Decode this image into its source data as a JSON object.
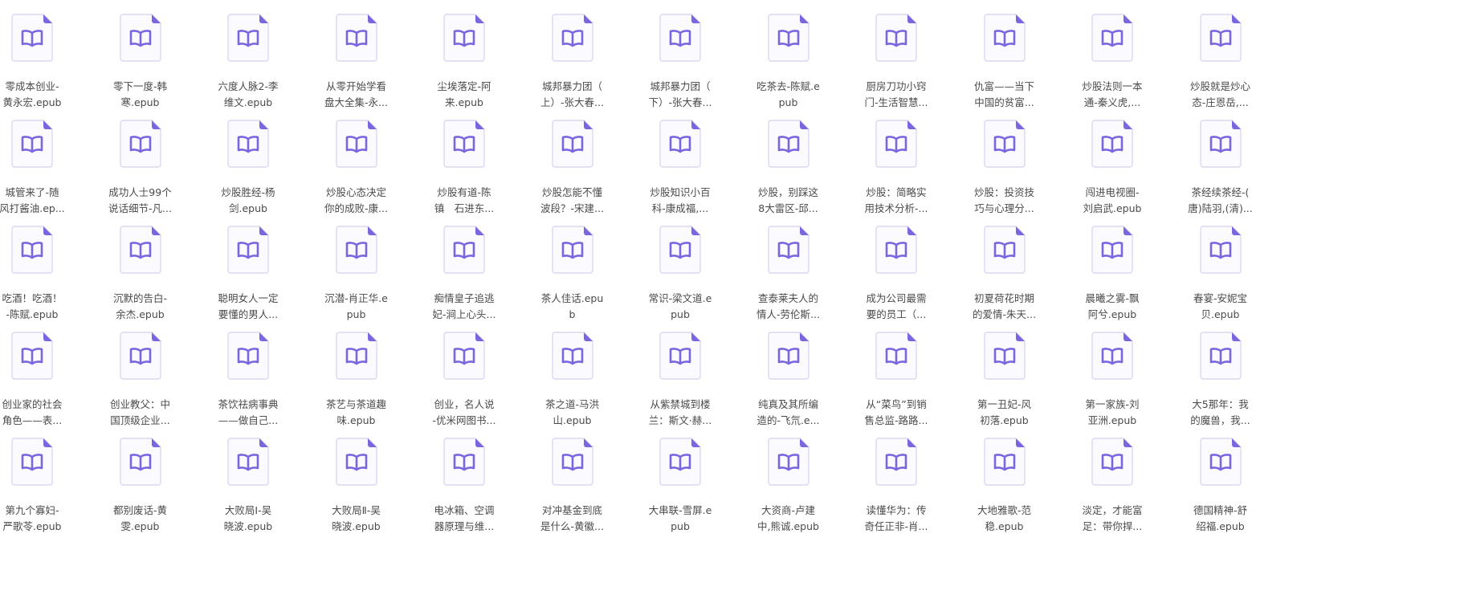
{
  "colors": {
    "icon_stroke": "#ded6f2",
    "icon_fill": "#fbfaff",
    "icon_accent": "#7b66e0",
    "text": "#4a4a4a"
  },
  "icon": "book-file-icon",
  "files": [
    {
      "line1": "零成本创业-",
      "line2": "黄永宏.epub"
    },
    {
      "line1": "零下一度-韩",
      "line2": "寒.epub"
    },
    {
      "line1": "六度人脉2-李",
      "line2": "维文.epub"
    },
    {
      "line1": "从零开始学看",
      "line2": "盘大全集-永..."
    },
    {
      "line1": "尘埃落定-阿",
      "line2": "来.epub"
    },
    {
      "line1": "城邦暴力团（",
      "line2": "上）-张大春..."
    },
    {
      "line1": "城邦暴力团（",
      "line2": "下）-张大春..."
    },
    {
      "line1": "吃茶去-陈赋.e",
      "line2": "pub"
    },
    {
      "line1": "厨房刀功小窍",
      "line2": "门-生活智慧..."
    },
    {
      "line1": "仇富——当下",
      "line2": "中国的贫富..."
    },
    {
      "line1": "炒股法则一本",
      "line2": "通-秦义虎,..."
    },
    {
      "line1": "炒股就是炒心",
      "line2": "态-庄恩岳,..."
    },
    {
      "line1": "城管来了-随",
      "line2": "风打酱油.ep..."
    },
    {
      "line1": "成功人士99个",
      "line2": "说话细节-凡..."
    },
    {
      "line1": "炒股胜经-杨",
      "line2": "剑.epub"
    },
    {
      "line1": "炒股心态决定",
      "line2": "你的成败-康..."
    },
    {
      "line1": "炒股有道-陈",
      "line2": "镇　石进东..."
    },
    {
      "line1": "炒股怎能不懂",
      "line2": "波段？-宋建..."
    },
    {
      "line1": "炒股知识小百",
      "line2": "科-康成福,..."
    },
    {
      "line1": "炒股，别踩这",
      "line2": "8大雷区-邱..."
    },
    {
      "line1": "炒股：简略实",
      "line2": "用技术分析-..."
    },
    {
      "line1": "炒股：投资技",
      "line2": "巧与心理分..."
    },
    {
      "line1": "闯进电视圈-",
      "line2": "刘启武.epub"
    },
    {
      "line1": "茶经续茶经-(",
      "line2": "唐)陆羽,(清)..."
    },
    {
      "line1": "吃酒！吃酒！",
      "line2": "-陈赋.epub"
    },
    {
      "line1": "沉默的告白-",
      "line2": "余杰.epub"
    },
    {
      "line1": "聪明女人一定",
      "line2": "要懂的男人..."
    },
    {
      "line1": "沉潜-肖正华.e",
      "line2": "pub"
    },
    {
      "line1": "痴情皇子追逃",
      "line2": "妃-涧上心头..."
    },
    {
      "line1": "茶人佳话.epu",
      "line2": "b"
    },
    {
      "line1": "常识-梁文道.e",
      "line2": "pub"
    },
    {
      "line1": "查泰莱夫人的",
      "line2": "情人-劳伦斯..."
    },
    {
      "line1": "成为公司最需",
      "line2": "要的员工（..."
    },
    {
      "line1": "初夏荷花时期",
      "line2": "的爱情-朱天..."
    },
    {
      "line1": "晨曦之雾-飘",
      "line2": "阿兮.epub"
    },
    {
      "line1": "春宴-安妮宝",
      "line2": "贝.epub"
    },
    {
      "line1": "创业家的社会",
      "line2": "角色——表..."
    },
    {
      "line1": "创业教父：中",
      "line2": "国顶级企业..."
    },
    {
      "line1": "茶饮祛病事典",
      "line2": "——做自己..."
    },
    {
      "line1": "茶艺与茶道趣",
      "line2": "味.epub"
    },
    {
      "line1": "创业，名人说",
      "line2": "-优米网图书..."
    },
    {
      "line1": "茶之道-马洪",
      "line2": "山.epub"
    },
    {
      "line1": "从紫禁城到楼",
      "line2": "兰：斯文·赫..."
    },
    {
      "line1": "纯真及其所编",
      "line2": "造的-飞氘.e..."
    },
    {
      "line1": "从“菜鸟”到销",
      "line2": "售总监-路路..."
    },
    {
      "line1": "第一丑妃-风",
      "line2": "初落.epub"
    },
    {
      "line1": "第一家族-刘",
      "line2": "亚洲.epub"
    },
    {
      "line1": "大5那年：我",
      "line2": "的魔兽，我..."
    },
    {
      "line1": "第九个寡妇-",
      "line2": "严歌苓.epub"
    },
    {
      "line1": "都别废话-黄",
      "line2": "雯.epub"
    },
    {
      "line1": "大败局Ⅰ-吴",
      "line2": "晓波.epub"
    },
    {
      "line1": "大败局Ⅱ-吴",
      "line2": "晓波.epub"
    },
    {
      "line1": "电冰箱、空调",
      "line2": "器原理与维..."
    },
    {
      "line1": "对冲基金到底",
      "line2": "是什么-黄徽..."
    },
    {
      "line1": "大串联-雪屏.e",
      "line2": "pub"
    },
    {
      "line1": "大资商-卢建",
      "line2": "中,熊诚.epub"
    },
    {
      "line1": "读懂华为：传",
      "line2": "奇任正非-肖..."
    },
    {
      "line1": "大地雅歌-范",
      "line2": "稳.epub"
    },
    {
      "line1": "淡定，才能富",
      "line2": "足：带你捍..."
    },
    {
      "line1": "德国精神-舒",
      "line2": "绍福.epub"
    }
  ]
}
